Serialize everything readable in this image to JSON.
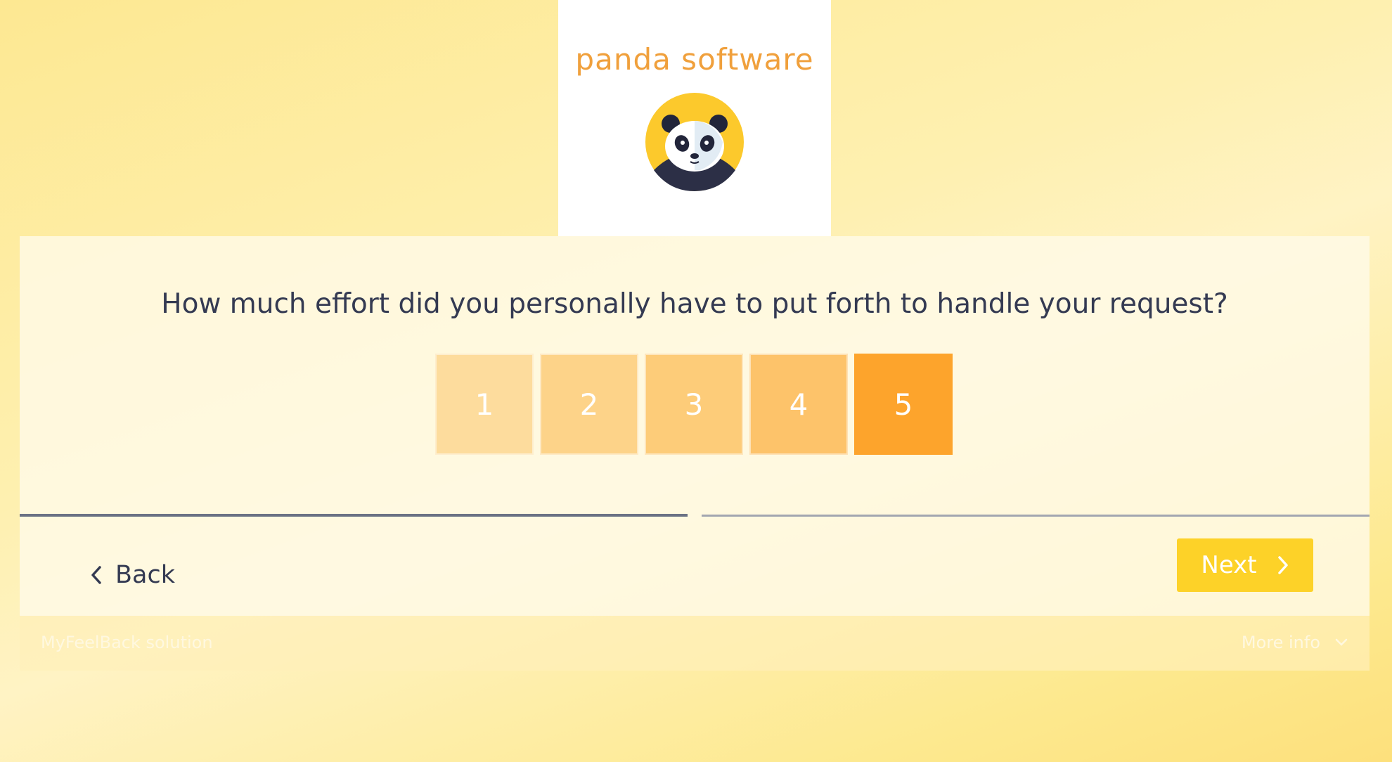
{
  "logo": {
    "brand_text": "panda software",
    "icon": "panda-icon"
  },
  "survey": {
    "question": "How much effort did you personally have to put forth to handle your request?",
    "scale": [
      {
        "label": "1",
        "color": "#fddc9d"
      },
      {
        "label": "2",
        "color": "#fdd389"
      },
      {
        "label": "3",
        "color": "#fdcc79"
      },
      {
        "label": "4",
        "color": "#fdc36a"
      },
      {
        "label": "5",
        "color": "#fda42c"
      }
    ],
    "selected_value": "5"
  },
  "progress": {
    "completed_fraction": 0.5
  },
  "navigation": {
    "back_label": "Back",
    "next_label": "Next"
  },
  "footer": {
    "brand_label": "MyFeelBack solution",
    "more_info_label": "More info"
  },
  "colors": {
    "accent": "#fdd228",
    "selected": "#fda42c",
    "text": "#343a52"
  }
}
